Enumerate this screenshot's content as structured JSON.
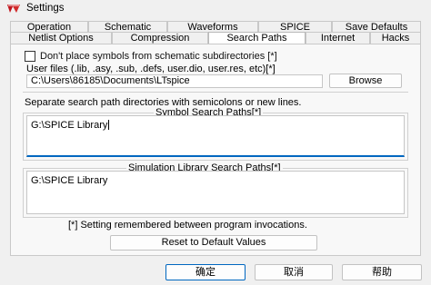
{
  "window": {
    "title": "Settings",
    "icon": "ltspice-icon"
  },
  "tabs": {
    "row1": [
      {
        "label": "Operation"
      },
      {
        "label": "Schematic"
      },
      {
        "label": "Waveforms"
      },
      {
        "label": "SPICE"
      },
      {
        "label": "Save Defaults"
      }
    ],
    "row2": [
      {
        "label": "Netlist Options"
      },
      {
        "label": "Compression"
      },
      {
        "label": "Search Paths",
        "active": true
      },
      {
        "label": "Internet"
      },
      {
        "label": "Hacks"
      }
    ]
  },
  "panel": {
    "no_subdir_checkbox_label": "Don't place symbols from schematic subdirectories [*]",
    "no_subdir_checked": false,
    "user_files": {
      "label": "User files (.lib, .asy, .sub, .defs, user.dio, user.res, etc)[*]",
      "value": "C:\\Users\\86185\\Documents\\LTspice",
      "browse_label": "Browse"
    },
    "separator_hint": "Separate search path directories with semicolons or new lines.",
    "symbol_search": {
      "label": "Symbol Search Paths[*]",
      "value": "G:\\SPICE Library"
    },
    "simulation_search": {
      "label": "Simulation Library Search Paths[*]",
      "value": "G:\\SPICE Library"
    },
    "remembered_note": "[*] Setting remembered between program invocations.",
    "reset_label": "Reset to Default Values"
  },
  "footer": {
    "ok_label": "确定",
    "cancel_label": "取消",
    "help_label": "帮助"
  },
  "colors": {
    "accent": "#0067c0",
    "window_bg": "#f0f0f0",
    "panel_bg": "#f8f8f8"
  }
}
